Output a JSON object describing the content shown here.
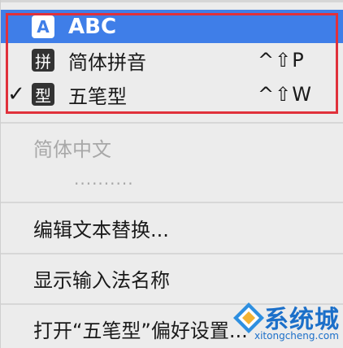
{
  "menu": {
    "input_sources": [
      {
        "label": "ABC",
        "badge": "A",
        "checked": false,
        "shortcut": "",
        "selected": true
      },
      {
        "label": "简体拼音",
        "badge": "拼",
        "checked": false,
        "shortcut": "^⇧P",
        "selected": false
      },
      {
        "label": "五笔型",
        "badge": "型",
        "checked": true,
        "shortcut": "^⇧W",
        "selected": false
      }
    ],
    "check_mark": "✓",
    "section_header": "简体中文",
    "placeholder_dots": "··········",
    "edit_text_replacement": "编辑文本替换...",
    "show_input_name": "显示输入法名称",
    "open_preferences": "打开“五笔型”偏好设置..."
  },
  "watermark": {
    "text": "系统城",
    "url": "xitongcheng.com"
  },
  "colors": {
    "selection": "#3f7ee8",
    "highlight_border": "#e0313b",
    "menu_bg": "#ececec"
  }
}
